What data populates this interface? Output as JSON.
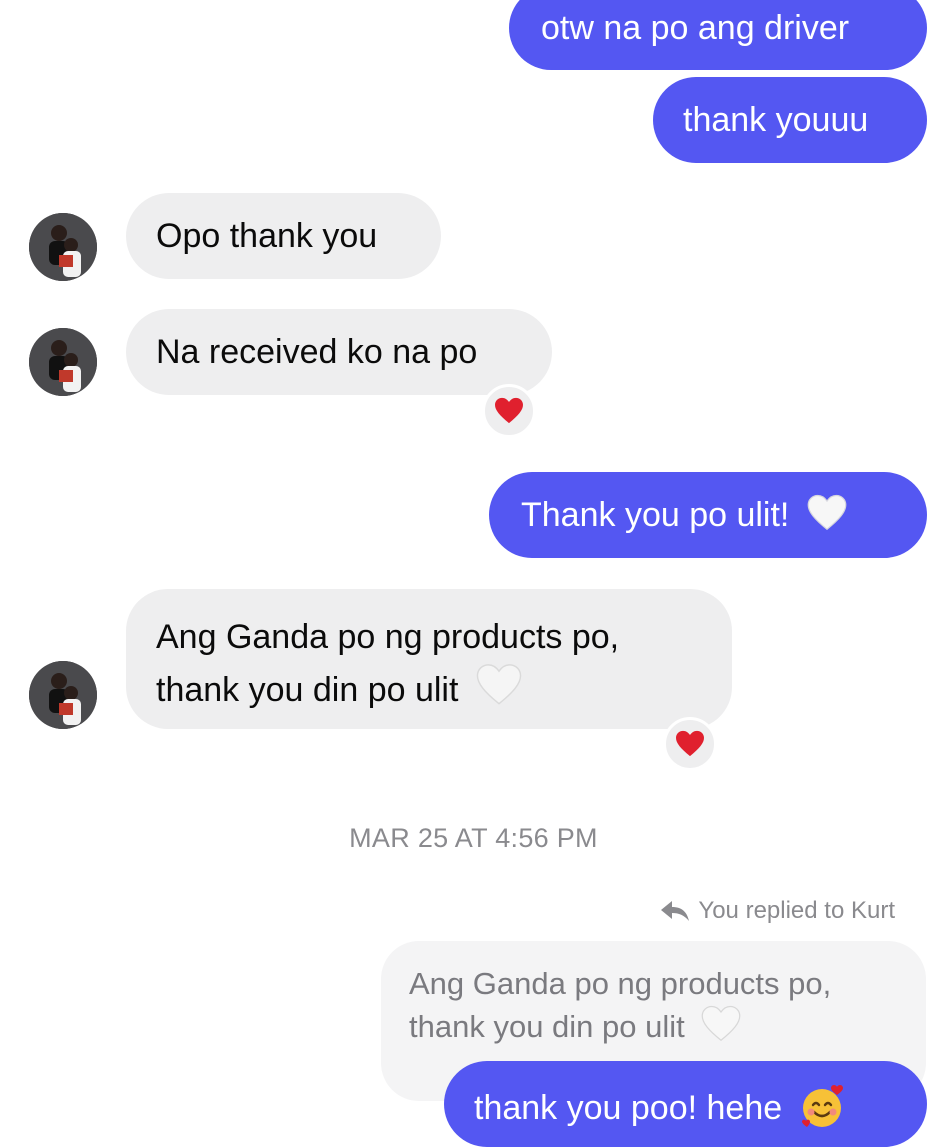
{
  "conversation": {
    "messages": [
      {
        "from": "me",
        "text": "otw na po ang driver"
      },
      {
        "from": "me",
        "text": "thank youuu"
      },
      {
        "from": "them",
        "text": "Opo thank you"
      },
      {
        "from": "them",
        "text": "Na received ko na po",
        "reaction": "red-heart"
      },
      {
        "from": "me",
        "text": "Thank you po ulit!",
        "emoji": "white-heart"
      },
      {
        "from": "them",
        "lines": [
          "Ang Ganda po ng products po,",
          "thank you din po ulit"
        ],
        "emoji": "white-heart",
        "reaction": "red-heart"
      }
    ],
    "timestamp": "MAR 25 AT 4:56 PM",
    "reply": {
      "label": "You replied to Kurt",
      "quoted_lines": [
        "Ang Ganda po ng products po,",
        "thank you din po ulit"
      ],
      "message": "thank you poo! hehe",
      "emoji": "smiling-face-with-hearts"
    }
  },
  "colors": {
    "outgoing_bubble": "#5457f2",
    "incoming_bubble": "#eeeeef",
    "reaction_heart": "#e0202e",
    "meta_text": "#8a8a8e"
  }
}
